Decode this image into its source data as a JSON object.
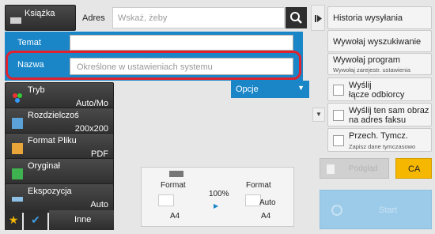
{
  "top": {
    "book_label": "Książka",
    "address_label": "Adres",
    "address_placeholder": "Wskaż, żeby"
  },
  "fields": {
    "subject_label": "Temat",
    "subject_value": "",
    "name_label": "Nazwa",
    "name_value": "Określone w ustawieniach systemu"
  },
  "left_menu": {
    "mode": {
      "label": "Tryb",
      "value": "Auto/Mo"
    },
    "resolution": {
      "label": "Rozdzielczoś",
      "value": "200x200"
    },
    "file_format": {
      "label": "Format Pliku",
      "value": "PDF"
    },
    "original": {
      "label": "Oryginał"
    },
    "exposure": {
      "label": "Ekspozycja",
      "value": "Auto"
    },
    "other_label": "Inne"
  },
  "options_label": "Opcje",
  "right_menu": {
    "history": "Historia wysyłania",
    "recall_search": "Wywołaj wyszukiwanie",
    "recall_program": "Wywołaj program",
    "recall_program_sub": "Wywołaj zarejestr. ustawienia",
    "send_recipient_line1": "Wyślij",
    "send_recipient_line2": "łącze odbiorcy",
    "send_fax_line1": "Wyślij ten sam obraz",
    "send_fax_line2": "na adres faksu",
    "temp_save": "Przech. Tymcz.",
    "temp_save_sub": "Zapisz dane tymczasowo"
  },
  "preview": {
    "format_left_label": "Format",
    "format_left_size": "A4",
    "zoom": "100%",
    "format_right_label": "Format",
    "format_right_value": "Auto",
    "format_right_size": "A4"
  },
  "actions": {
    "preview_label": "Podgląd",
    "ca_label": "CA",
    "start_label": "Start"
  },
  "colors": {
    "accent": "#1a86c8",
    "highlight": "#e0222e",
    "dark": "#2d2d2d",
    "ca": "#f5b700"
  }
}
